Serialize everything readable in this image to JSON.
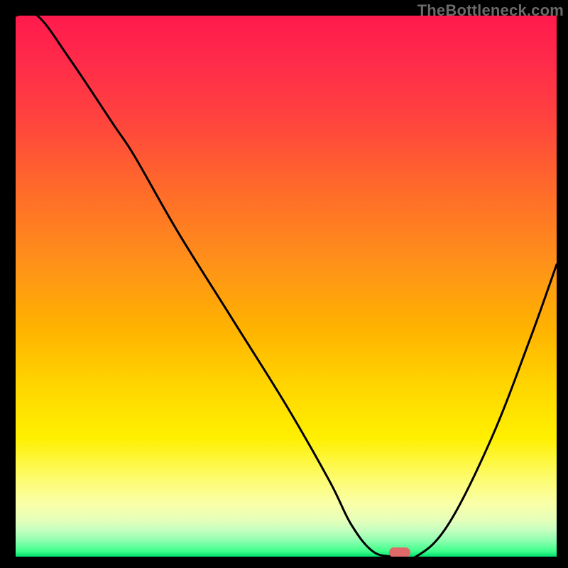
{
  "watermark": {
    "text": "TheBottleneck.com"
  },
  "colors": {
    "curve_stroke": "#000000",
    "marker_fill": "#e06a6a",
    "frame_bg": "#000000"
  },
  "chart_data": {
    "type": "line",
    "title": "",
    "xlabel": "",
    "ylabel": "",
    "xlim": [
      0,
      100
    ],
    "ylim": [
      0,
      100
    ],
    "grid": false,
    "legend": false,
    "series": [
      {
        "name": "bottleneck-curve",
        "x": [
          0,
          4,
          10,
          18,
          22,
          30,
          40,
          50,
          58,
          62,
          66,
          70,
          74,
          80,
          88,
          95,
          100
        ],
        "y": [
          100,
          100,
          92,
          80,
          74,
          60,
          44,
          28,
          14,
          6,
          1,
          0,
          0,
          6,
          22,
          40,
          54
        ]
      }
    ],
    "marker": {
      "x": 71,
      "y": 0.8,
      "shape": "pill"
    }
  }
}
